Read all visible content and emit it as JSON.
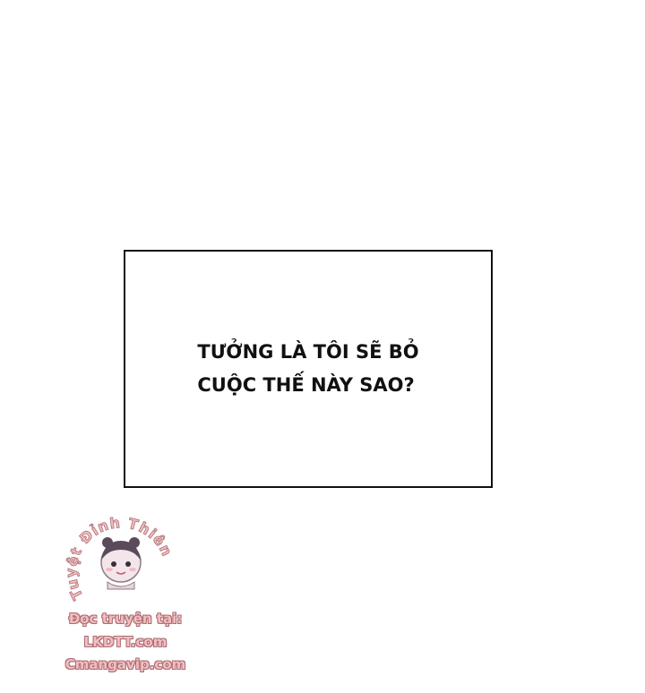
{
  "narration": {
    "lines": [
      "TƯỞNG LÀ TÔI SẼ BỎ",
      "CUỘC THẾ NÀY SAO?"
    ]
  },
  "watermark": {
    "arc_text": "Tuyệt Đỉnh Thiên",
    "lines": [
      "Đọc truyện tại:",
      "LKDTT.com",
      "Cmangavip.com"
    ],
    "fill_color": "#f6bcc0",
    "outline_color": "#a86f74",
    "mascot_icon": "chibi-girl-icon"
  },
  "colors": {
    "background": "#ffffff",
    "border": "#111111",
    "text": "#111111"
  }
}
